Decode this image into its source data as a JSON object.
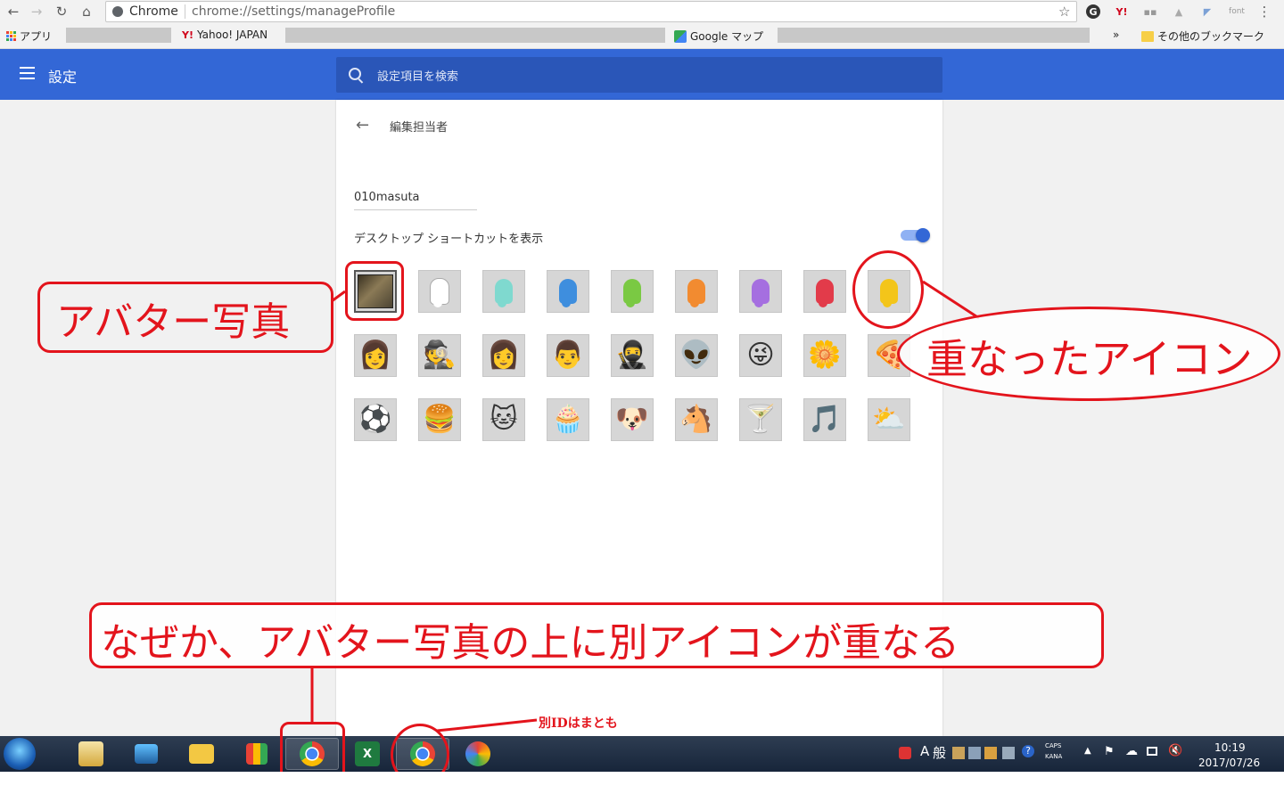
{
  "browser": {
    "tab_site": "Chrome",
    "url": "chrome://settings/manageProfile",
    "bookmarks": {
      "apps": "アプリ",
      "yahoo": "Yahoo! JAPAN",
      "maps": "Google マップ",
      "overflow": "»",
      "other": "その他のブックマーク"
    },
    "ext_font": "font"
  },
  "settings": {
    "header_title": "設定",
    "search_placeholder": "設定項目を検索",
    "page_title": "編集担当者",
    "profile_name": "010masuta",
    "shortcut_label": "デスクトップ ショートカットを表示",
    "shortcut_enabled": true
  },
  "avatars": {
    "row1_colors": [
      "#ffffff",
      "#7fd9cf",
      "#3e8ede",
      "#7ac943",
      "#f28b30",
      "#a56fe0",
      "#e23b4a",
      "#f3c51a"
    ],
    "row2": [
      "👩",
      "🕵",
      "👩",
      "👨",
      "🥷",
      "👽",
      "😜",
      "🌼",
      "🍕"
    ],
    "row3": [
      "⚽",
      "🍔",
      "🐱",
      "🧁",
      "🐶",
      "🐴",
      "🍸",
      "🎵",
      "⛅"
    ]
  },
  "annotations": {
    "avatar_photo": "アバター写真",
    "overlapping_icon": "重なったアイコン",
    "explanation": "なぜか、アバター写真の上に別アイコンが重なる",
    "other_id": "別IDはまとも"
  },
  "taskbar": {
    "time": "10:19",
    "date": "2017/07/26",
    "ime_a": "A",
    "ime_mode": "般",
    "caps": "CAPS",
    "kana": "KANA"
  }
}
